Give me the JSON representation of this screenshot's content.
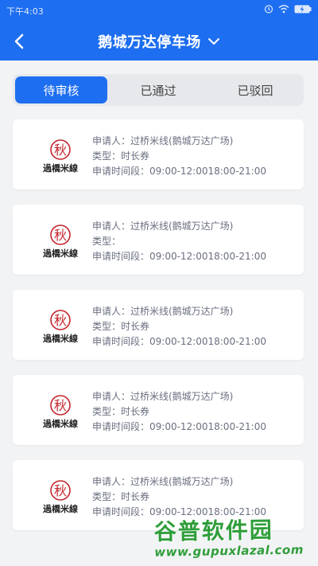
{
  "status_bar": {
    "time": "下午4:03"
  },
  "header": {
    "title": "鹅城万达停车场"
  },
  "tabs": [
    {
      "label": "待审核",
      "active": true
    },
    {
      "label": "已通过",
      "active": false
    },
    {
      "label": "已驳回",
      "active": false
    }
  ],
  "cards": [
    {
      "applicant": "申请人：过桥米线(鹅城万达广场)",
      "type": "类型：时长券",
      "period": "申请时间段：09:00-12:0018:00-21:00"
    },
    {
      "applicant": "申请人：过桥米线(鹅城万达广场)",
      "type": "类型：",
      "period": "申请时间段：09:00-12:0018:00-21:00"
    },
    {
      "applicant": "申请人：过桥米线(鹅城万达广场)",
      "type": "类型：时长券",
      "period": "申请时间段：09:00-12:0018:00-21:00"
    },
    {
      "applicant": "申请人：过桥米线(鹅城万达广场)",
      "type": "类型：时长券",
      "period": "申请时间段：09:00-12:0018:00-21:00"
    },
    {
      "applicant": "申请人：过桥米线(鹅城万达广场)",
      "type": "类型：时长券",
      "period": "申请时间段：09:00-12:0018:00-21:00"
    }
  ],
  "logo": {
    "seal_text": "秋",
    "brand_text": "過橋米線"
  },
  "watermark": {
    "title": "谷普软件园",
    "url": "www.gupuxlazal.com"
  },
  "colors": {
    "primary": "#1d6ef0",
    "logo_red": "#c4242c",
    "watermark_green": "#2f9e3a"
  }
}
